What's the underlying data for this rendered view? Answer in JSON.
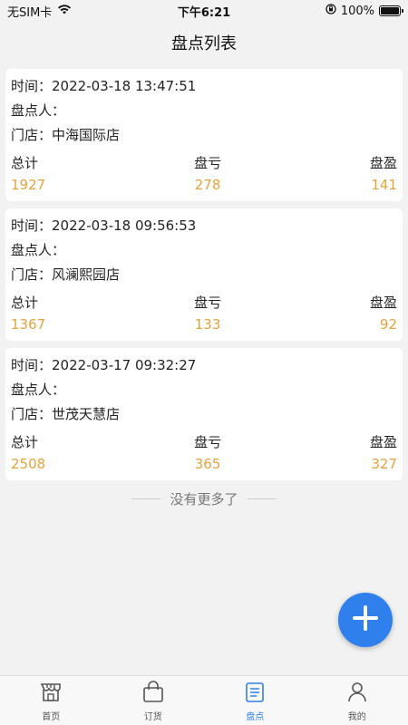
{
  "status_bar": {
    "carrier": "无SIM卡",
    "time": "下午6:21",
    "battery": "100%"
  },
  "header": {
    "title": "盘点列表"
  },
  "records": [
    {
      "time_label": "时间：",
      "time": "2022-03-18 13:47:51",
      "counter_label": "盘点人：",
      "counter": "",
      "store_label": "门店：",
      "store": "中海国际店",
      "total_label": "总计",
      "total": "1927",
      "loss_label": "盘亏",
      "loss": "278",
      "gain_label": "盘盈",
      "gain": "141"
    },
    {
      "time_label": "时间：",
      "time": "2022-03-18 09:56:53",
      "counter_label": "盘点人：",
      "counter": "",
      "store_label": "门店：",
      "store": "风澜熙园店",
      "total_label": "总计",
      "total": "1367",
      "loss_label": "盘亏",
      "loss": "133",
      "gain_label": "盘盈",
      "gain": "92"
    },
    {
      "time_label": "时间：",
      "time": "2022-03-17 09:32:27",
      "counter_label": "盘点人：",
      "counter": "",
      "store_label": "门店：",
      "store": "世茂天慧店",
      "total_label": "总计",
      "total": "2508",
      "loss_label": "盘亏",
      "loss": "365",
      "gain_label": "盘盈",
      "gain": "327"
    }
  ],
  "list_footer": "没有更多了",
  "tabbar": {
    "items": [
      {
        "label": "首页",
        "icon": "storefront-icon"
      },
      {
        "label": "订货",
        "icon": "shopping-bag-icon"
      },
      {
        "label": "盘点",
        "icon": "inventory-icon"
      },
      {
        "label": "我的",
        "icon": "profile-icon"
      }
    ]
  },
  "colors": {
    "accent": "#2f80ed",
    "value": "#e6a23c"
  }
}
